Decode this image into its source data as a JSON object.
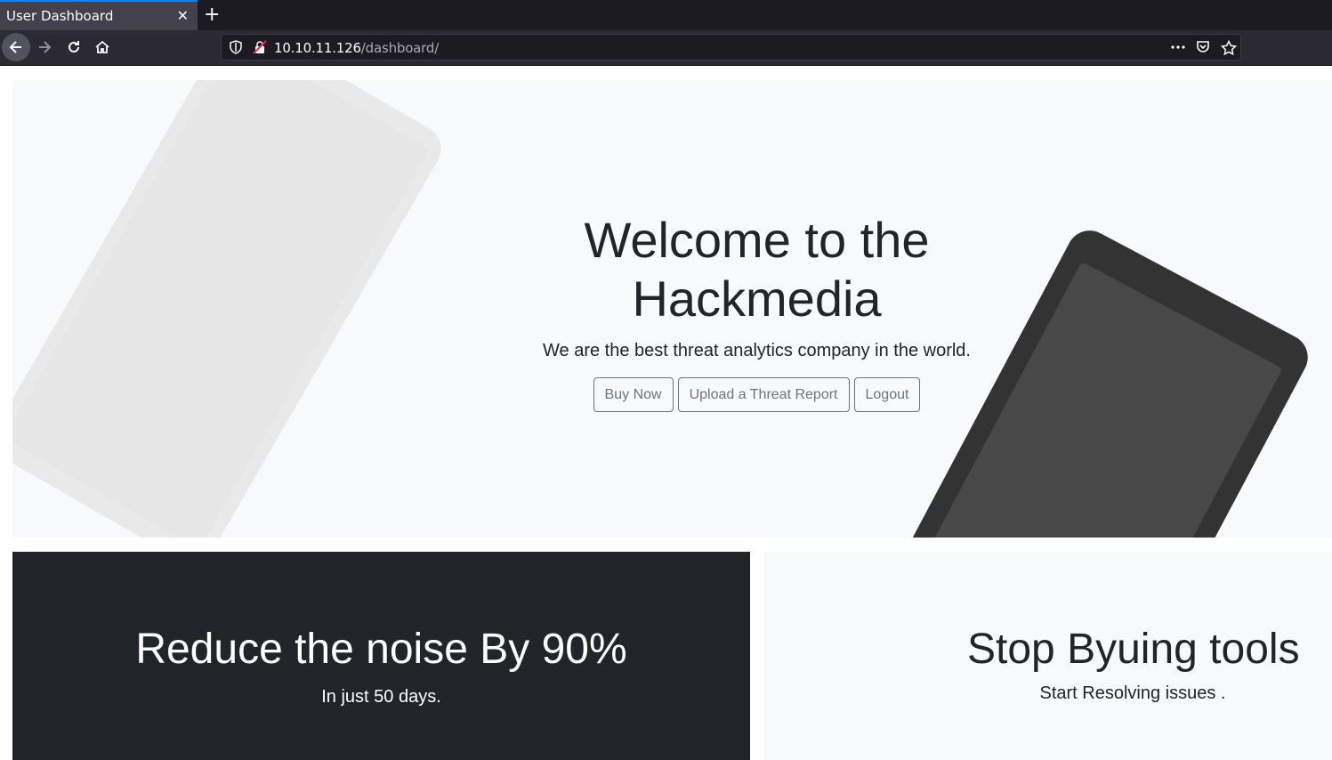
{
  "browser": {
    "tab_title": "User Dashboard",
    "url_host": "10.10.11.126",
    "url_path": "/dashboard/"
  },
  "icons": {
    "close": "close-icon",
    "new_tab": "plus-icon",
    "back": "arrow-left-icon",
    "forward": "arrow-right-icon",
    "reload": "reload-icon",
    "home": "home-icon",
    "shield": "shield-icon",
    "insecure": "insecure-lock-icon",
    "more": "more-icon",
    "pocket": "pocket-icon",
    "bookmark": "star-icon"
  },
  "hero": {
    "title": "Welcome to the Hackmedia",
    "lead": "We are the best threat analytics company in the world.",
    "buttons": {
      "buy": "Buy Now",
      "upload": "Upload a Threat Report",
      "logout": "Logout"
    }
  },
  "features": [
    {
      "title": "Reduce the noise By 90%",
      "subtitle": "In just 50 days."
    },
    {
      "title": "Stop Byuing tools",
      "subtitle": "Start Resolving issues ."
    }
  ],
  "colors": {
    "dark": "#212529",
    "light": "#f8f9fa",
    "secondary": "#6c757d"
  }
}
